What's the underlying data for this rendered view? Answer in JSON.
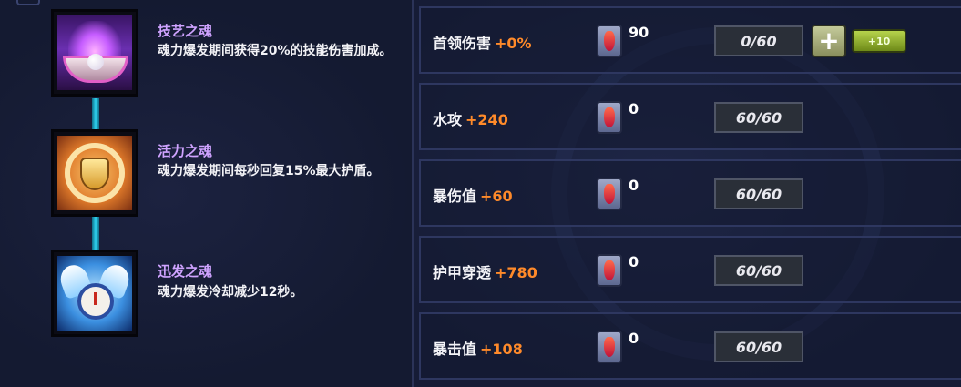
{
  "souls": [
    {
      "name": "技艺之魂",
      "desc": "魂力爆发期间获得20%的技能伤害加成。",
      "icon": "soul-of-skill-icon"
    },
    {
      "name": "活力之魂",
      "desc": "魂力爆发期间每秒回复15%最大护盾。",
      "icon": "soul-of-vitality-icon"
    },
    {
      "name": "迅发之魂",
      "desc": "魂力爆发冷却减少12秒。",
      "icon": "soul-of-swiftness-icon"
    }
  ],
  "stats": [
    {
      "label": "首领伤害",
      "bonus": "+0%",
      "gems": "90",
      "level": "0/60",
      "plus_label": "+",
      "plus10_label": "+10"
    },
    {
      "label": "水攻",
      "bonus": "+240",
      "gems": "0",
      "level": "60/60"
    },
    {
      "label": "暴伤值",
      "bonus": "+60",
      "gems": "0",
      "level": "60/60"
    },
    {
      "label": "护甲穿透",
      "bonus": "+780",
      "gems": "0",
      "level": "60/60"
    },
    {
      "label": "暴击值",
      "bonus": "+108",
      "gems": "0",
      "level": "60/60"
    }
  ],
  "colors": {
    "soul_title": "#cfa3ff",
    "bonus": "#ff8a2a",
    "connector": "#2fd3f0",
    "plus10_button": "#9cc233"
  }
}
